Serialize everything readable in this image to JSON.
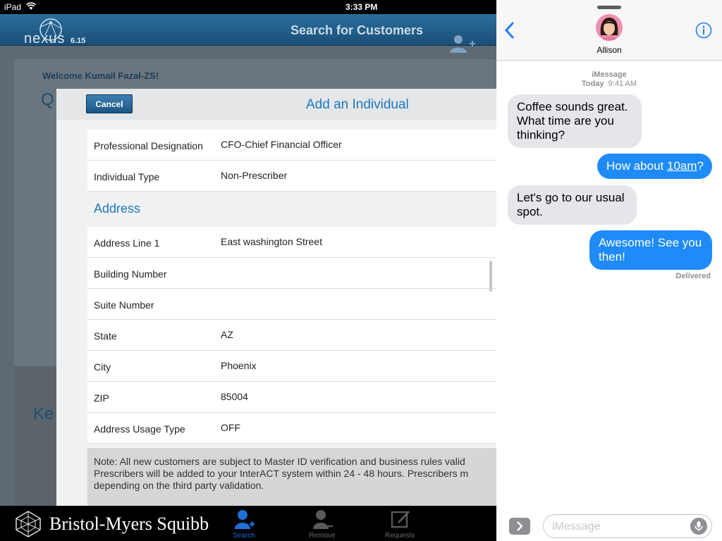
{
  "status": {
    "carrier": "iPad",
    "time": "3:33 PM"
  },
  "app": {
    "name": "nexus",
    "version": "6.15",
    "header_title": "Search for Customers",
    "welcome": "Welcome Kumail Fazal-ZS!",
    "bg_heading_1": "Q",
    "bg_heading_2": "Ke"
  },
  "modal": {
    "title": "Add an Individual",
    "cancel_label": "Cancel",
    "rows_top": [
      {
        "label": "Professional Designation",
        "value": "CFO-Chief Financial Officer"
      },
      {
        "label": "Individual Type",
        "value": "Non-Prescriber"
      }
    ],
    "section_address": "Address",
    "address_rows": [
      {
        "label": "Address Line 1",
        "value": "East washington Street"
      },
      {
        "label": "Building Number",
        "value": ""
      },
      {
        "label": "Suite Number",
        "value": ""
      },
      {
        "label": "State",
        "value": "AZ"
      },
      {
        "label": "City",
        "value": "Phoenix"
      },
      {
        "label": "ZIP",
        "value": "85004"
      },
      {
        "label": "Address Usage Type",
        "value": "OFF"
      }
    ],
    "note_lines": [
      "Note: All new customers are subject to Master ID verification and business rules valid",
      "Prescribers will be added to your InterACT system within 24 - 48 hours. Prescribers m",
      "depending on the third party validation."
    ]
  },
  "bottom": {
    "brand": "Bristol-Myers Squibb",
    "tabs": [
      {
        "label": "Search",
        "active": true
      },
      {
        "label": "Remove",
        "active": false
      },
      {
        "label": "Requests",
        "active": false
      }
    ]
  },
  "messages": {
    "contact": "Allison",
    "service": "iMessage",
    "timestamp_day": "Today",
    "timestamp_time": "9:41 AM",
    "m1": "Coffee sounds great. What time are you thinking?",
    "m2_prefix": "How about ",
    "m2_link": "10am",
    "m2_suffix": "?",
    "m3": "Let's go to our usual spot.",
    "m4": "Awesome! See you then!",
    "delivered": "Delivered",
    "input_placeholder": "iMessage"
  },
  "colors": {
    "accent": "#1e78c2",
    "bubble_out": "#1e8bf9",
    "bubble_in": "#e5e5ea"
  }
}
